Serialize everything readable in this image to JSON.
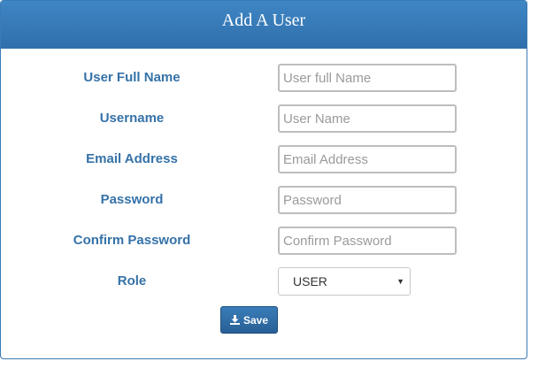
{
  "form": {
    "title": "Add A User",
    "fields": [
      {
        "label": "User Full Name",
        "placeholder": "User full Name",
        "value": ""
      },
      {
        "label": "Username",
        "placeholder": "User Name",
        "value": ""
      },
      {
        "label": "Email Address",
        "placeholder": "Email Address",
        "value": ""
      },
      {
        "label": "Password",
        "placeholder": "Password",
        "value": ""
      },
      {
        "label": "Confirm Password",
        "placeholder": "Confirm Password",
        "value": ""
      }
    ],
    "role": {
      "label": "Role",
      "selected": "USER"
    },
    "save_label": "Save"
  },
  "colors": {
    "header": "#3479b8",
    "label": "#3572a8",
    "button": "#2f6fab"
  },
  "icons": {
    "save": "download-icon",
    "select_arrow": "triangle-down"
  }
}
